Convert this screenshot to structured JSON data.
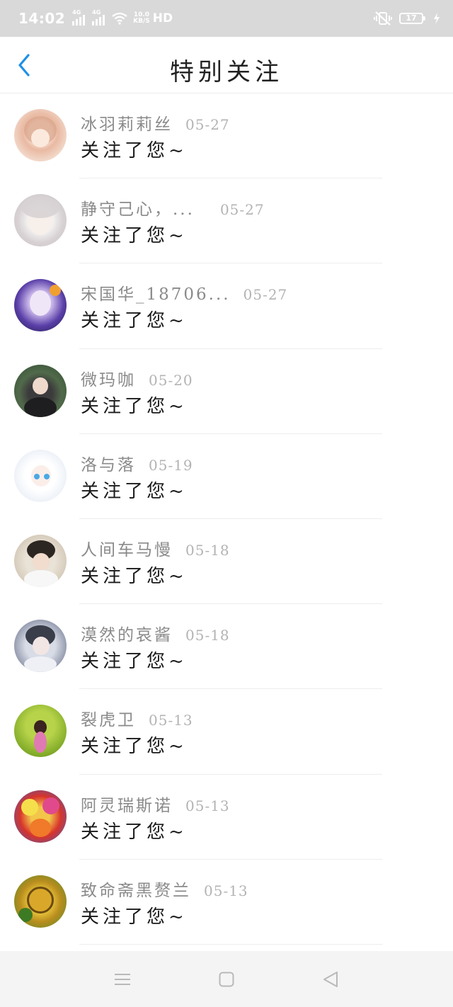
{
  "status_bar": {
    "time": "14:02",
    "network_1": "4G",
    "network_2": "4G",
    "speed_value": "10.0",
    "speed_unit": "KB/S",
    "hd": "HD",
    "battery": "17"
  },
  "header": {
    "title": "特别关注",
    "back_icon": "chevron-left-icon"
  },
  "colors": {
    "accent": "#1e90e6",
    "status_bar_bg": "#d9d9d9",
    "name_text": "#8a8a8a",
    "date_text": "#b3b3b3"
  },
  "follows": [
    {
      "name": "冰羽莉莉丝",
      "date": "05-27",
      "message": "关注了您~"
    },
    {
      "name": "静守己心，...",
      "date": "05-27",
      "message": "关注了您~"
    },
    {
      "name": "宋国华_18706...",
      "date": "05-27",
      "message": "关注了您~"
    },
    {
      "name": "微玛咖",
      "date": "05-20",
      "message": "关注了您~"
    },
    {
      "name": "洛与落",
      "date": "05-19",
      "message": "关注了您~"
    },
    {
      "name": "人间车马慢",
      "date": "05-18",
      "message": "关注了您~"
    },
    {
      "name": "漠然的哀酱",
      "date": "05-18",
      "message": "关注了您~"
    },
    {
      "name": "裂虎卫",
      "date": "05-13",
      "message": "关注了您~"
    },
    {
      "name": "阿灵瑞斯诺",
      "date": "05-13",
      "message": "关注了您~"
    },
    {
      "name": "致命斋黑赘兰",
      "date": "05-13",
      "message": "关注了您~"
    }
  ],
  "bottom_nav": {
    "menu_icon": "menu-icon",
    "home_icon": "home-square-icon",
    "back_icon": "back-triangle-icon"
  }
}
